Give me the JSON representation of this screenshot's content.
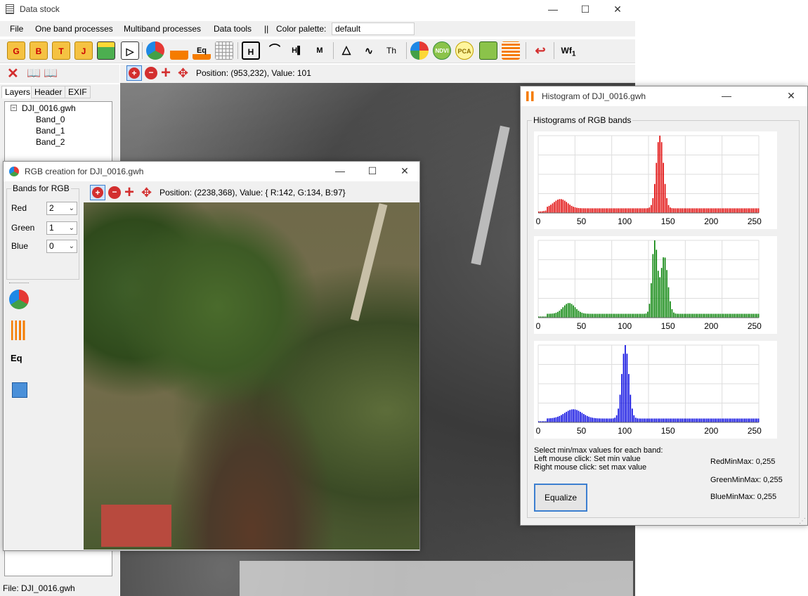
{
  "main": {
    "title": "Data stock",
    "menu": [
      "File",
      "One band processes",
      "Multiband processes",
      "Data tools",
      "||",
      "Color palette:"
    ],
    "palette_value": "default",
    "toolbar_letters": [
      "G",
      "B",
      "T",
      "J"
    ],
    "toolbar_labels": {
      "eq": "Eq",
      "h": "H",
      "ndvi": "NDVI",
      "pca": "PCA",
      "wf": "Wf",
      "wf_sub": "1",
      "th": "Th"
    },
    "position_text": "Position: (953,232), Value: 101",
    "tabs": [
      "Layers",
      "Header",
      "EXIF"
    ],
    "tree": {
      "root": "DJI_0016.gwh",
      "bands": [
        "Band_0",
        "Band_1",
        "Band_2"
      ]
    },
    "status": "File: DJI_0016.gwh"
  },
  "rgb": {
    "title": "RGB creation for DJI_0016.gwh",
    "group": "Bands for RGB",
    "rows": [
      {
        "label": "Red",
        "value": "2"
      },
      {
        "label": "Green",
        "value": "1"
      },
      {
        "label": "Blue",
        "value": "0"
      }
    ],
    "position_text": "Position: (2238,368), Value: { R:142, G:134, B:97}",
    "eq_label": "Eq"
  },
  "hist": {
    "title": "Histogram of DJI_0016.gwh",
    "group": "Histograms of RGB bands",
    "instructions": [
      "Select min/max values for each band:",
      "Left mouse click: Set min value",
      "Right mouse click: set max value"
    ],
    "red_minmax": "RedMinMax: 0,255",
    "green_minmax": "GreenMinMax: 0,255",
    "blue_minmax": "BlueMinMax: 0,255",
    "equalize": "Equalize",
    "x_ticks": [
      "0",
      "50",
      "100",
      "150",
      "200",
      "250"
    ]
  },
  "colors": {
    "red": "#e00000",
    "green": "#008000",
    "blue": "#0000e0",
    "accent": "#3c7fd0"
  },
  "chart_data": [
    {
      "type": "bar",
      "name": "Red",
      "xlim": [
        0,
        255
      ],
      "peaks": [
        {
          "x": 25,
          "h": 0.12,
          "w": 8
        },
        {
          "x": 140,
          "h": 0.97,
          "w": 4
        }
      ],
      "baseline": 0.06
    },
    {
      "type": "bar",
      "name": "Green",
      "xlim": [
        0,
        255
      ],
      "peaks": [
        {
          "x": 35,
          "h": 0.14,
          "w": 7
        },
        {
          "x": 134,
          "h": 0.96,
          "w": 3
        },
        {
          "x": 145,
          "h": 0.75,
          "w": 4
        }
      ],
      "baseline": 0.05
    },
    {
      "type": "bar",
      "name": "Blue",
      "xlim": [
        0,
        255
      ],
      "peaks": [
        {
          "x": 40,
          "h": 0.12,
          "w": 10
        },
        {
          "x": 100,
          "h": 0.95,
          "w": 4
        }
      ],
      "baseline": 0.05
    }
  ]
}
